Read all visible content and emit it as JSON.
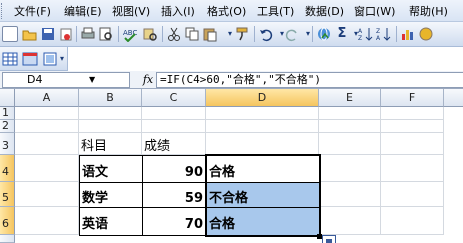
{
  "menubar": {
    "items": [
      "文件(F)",
      "编辑(E)",
      "视图(V)",
      "插入(I)",
      "格式(O)",
      "工具(T)",
      "数据(D)",
      "窗口(W)",
      "帮助(H)"
    ]
  },
  "toolbar": {
    "icons": [
      "new-icon",
      "open-icon",
      "save-icon",
      "permission-icon",
      "print-icon",
      "print-preview-icon",
      "spelling-icon",
      "research-icon",
      "cut-icon",
      "copy-icon",
      "paste-icon",
      "format-painter-icon",
      "undo-icon",
      "redo-icon",
      "hyperlink-icon",
      "autosum-icon",
      "sort-ascending-icon",
      "sort-descending-icon",
      "chart-wizard-icon",
      "drawing-icon"
    ],
    "autosum_glyph": "Σ"
  },
  "formula_bar": {
    "name_box": "D4",
    "fx_label": "fx",
    "formula": "=IF(C4>60,\"合格\",\"不合格\")"
  },
  "sheet": {
    "columns": [
      "A",
      "B",
      "C",
      "D",
      "E",
      "F"
    ],
    "rows": [
      "1",
      "2",
      "3",
      "4",
      "5",
      "6"
    ],
    "selected_column": "D",
    "cells": {
      "B3": "科目",
      "C3": "成绩",
      "B4": "语文",
      "C4": "90",
      "D4": "合格",
      "B5": "数学",
      "C5": "59",
      "D5": "不合格",
      "B6": "英语",
      "C6": "70",
      "D6": "合格"
    }
  },
  "colors": {
    "selection_fill": "#a8c8ec",
    "header_highlight": "#f5c55f"
  }
}
